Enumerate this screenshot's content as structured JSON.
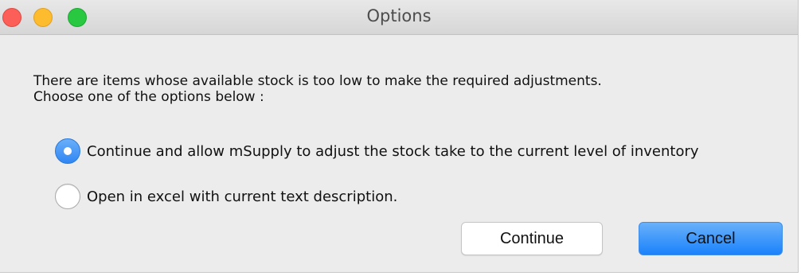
{
  "window": {
    "title": "Options"
  },
  "message": "There are items whose available stock is too low to make the required adjustments. Choose one of the options below :",
  "options": [
    {
      "label": "Continue and allow mSupply to adjust the stock take to the current level of inventory",
      "selected": true
    },
    {
      "label": "Open in excel with current text description.",
      "selected": false
    }
  ],
  "buttons": {
    "continue_label": "Continue",
    "cancel_label": "Cancel"
  },
  "colors": {
    "close": "#fc5f57",
    "minimize": "#fdbc2e",
    "maximize": "#28c840",
    "accent": "#2f86f3"
  }
}
